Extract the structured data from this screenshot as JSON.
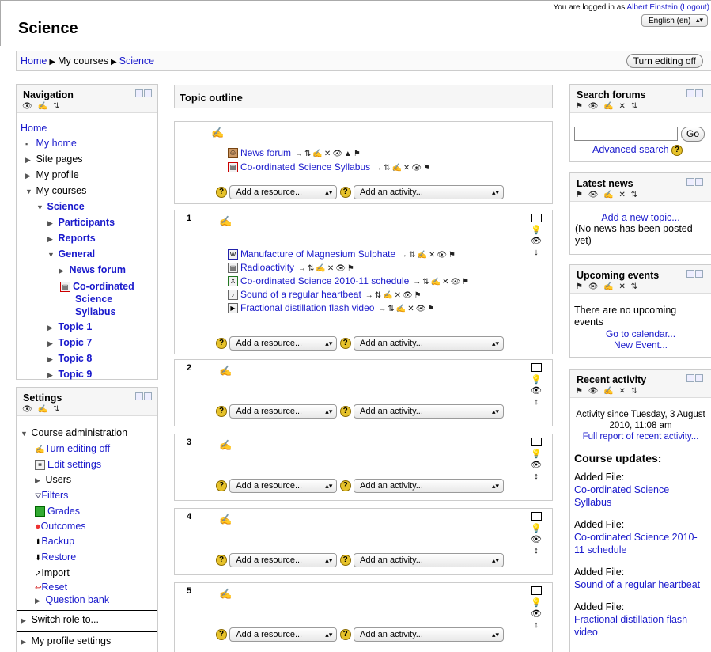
{
  "header": {
    "site_title": "Science",
    "login_prefix": "You are logged in as ",
    "user_name": "Albert Einstein",
    "logout_label": "(Logout)",
    "language": "English (en)"
  },
  "navbar": {
    "crumbs": [
      "Home",
      "My courses",
      "Science"
    ],
    "edit_toggle": "Turn editing off"
  },
  "navigation": {
    "title": "Navigation",
    "home": "Home",
    "my_home": "My home",
    "site_pages": "Site pages",
    "my_profile": "My profile",
    "my_courses": "My courses",
    "course": "Science",
    "participants": "Participants",
    "reports": "Reports",
    "general": "General",
    "news_forum": "News forum",
    "syllabus_l1": "Co-ordinated",
    "syllabus_l2": "Science",
    "syllabus_l3": "Syllabus",
    "topics": [
      "Topic 1",
      "Topic 7",
      "Topic 8",
      "Topic 9"
    ]
  },
  "settings": {
    "title": "Settings",
    "course_admin": "Course administration",
    "items": [
      "Turn editing off",
      "Edit settings",
      "Users",
      "Filters",
      "Grades",
      "Outcomes",
      "Backup",
      "Restore",
      "Import",
      "Reset",
      "Question bank"
    ],
    "switch_role": "Switch role to...",
    "profile_settings": "My profile settings"
  },
  "main": {
    "outline_title": "Topic outline",
    "add_resource": "Add a resource...",
    "add_activity": "Add an activity...",
    "section0_items": [
      "News forum",
      "Co-ordinated Science Syllabus"
    ],
    "section_numbers": [
      "1",
      "2",
      "3",
      "4",
      "5"
    ],
    "section1_items": [
      "Manufacture of Magnesium Sulphate",
      "Radioactivity",
      "Co-ordinated Science 2010-11 schedule",
      "Sound of a regular heartbeat",
      "Fractional distillation flash video"
    ]
  },
  "search": {
    "title": "Search forums",
    "go": "Go",
    "advanced": "Advanced search"
  },
  "news": {
    "title": "Latest news",
    "add_topic": "Add a new topic...",
    "empty": "(No news has been posted yet)"
  },
  "events": {
    "title": "Upcoming events",
    "none": "There are no upcoming events",
    "calendar": "Go to calendar...",
    "new_event": "New Event..."
  },
  "recent": {
    "title": "Recent activity",
    "since": "Activity since Tuesday, 3 August 2010, 11:08 am",
    "full_report": "Full report of recent activity...",
    "updates_heading": "Course updates:",
    "added_label": "Added File:",
    "files": [
      "Co-ordinated Science Syllabus",
      "Co-ordinated Science 2010-11 schedule",
      "Sound of a regular heartbeat",
      "Fractional distillation flash video"
    ]
  }
}
